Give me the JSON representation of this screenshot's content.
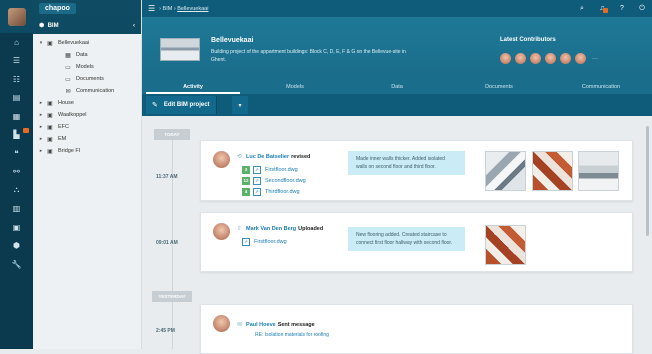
{
  "iconbar": {
    "items": [
      {
        "icon": "home-icon",
        "glyph": "⌂"
      },
      {
        "icon": "list-icon",
        "glyph": "☰"
      },
      {
        "icon": "users-icon",
        "glyph": "☷"
      },
      {
        "icon": "calendar-icon",
        "glyph": "▤"
      },
      {
        "icon": "clipboard-icon",
        "glyph": "▦"
      },
      {
        "icon": "chart-icon",
        "glyph": "▙"
      },
      {
        "icon": "quote-icon",
        "glyph": "❝"
      },
      {
        "icon": "link-icon",
        "glyph": "⚯"
      },
      {
        "icon": "sitemap-icon",
        "glyph": "⛬"
      },
      {
        "icon": "table-icon",
        "glyph": "▥"
      },
      {
        "icon": "folder-icon",
        "glyph": "▣"
      },
      {
        "icon": "cube-icon",
        "glyph": "⬢"
      },
      {
        "icon": "wrench-icon",
        "glyph": "🔧"
      }
    ]
  },
  "sidebar": {
    "brand": "chapoo",
    "section": "BIM",
    "tree": [
      {
        "label": "Bellevuekaai",
        "level": 1,
        "toggle": "▾",
        "icon": "▣"
      },
      {
        "label": "Data",
        "level": 2,
        "toggle": "",
        "icon": "▦"
      },
      {
        "label": "Models",
        "level": 2,
        "toggle": "",
        "icon": "▭"
      },
      {
        "label": "Documents",
        "level": 2,
        "toggle": "",
        "icon": "▭"
      },
      {
        "label": "Communication",
        "level": 2,
        "toggle": "",
        "icon": "✉"
      },
      {
        "label": "House",
        "level": 1,
        "toggle": "▸",
        "icon": "▣"
      },
      {
        "label": "Waalkoppel",
        "level": 1,
        "toggle": "▸",
        "icon": "▣"
      },
      {
        "label": "EFC",
        "level": 1,
        "toggle": "▸",
        "icon": "▣"
      },
      {
        "label": "EM",
        "level": 1,
        "toggle": "▸",
        "icon": "▣"
      },
      {
        "label": "Bridge FI",
        "level": 1,
        "toggle": "▸",
        "icon": "▣"
      }
    ]
  },
  "topbar": {
    "crumb_root": "BIM",
    "crumb_sep": "›",
    "crumb_current": "Bellevuekaai"
  },
  "header": {
    "title": "Bellevuekaai",
    "description": "Building project of the appartment buildings: Block C, D, E, F & G on the Bellevue-site in Ghent.",
    "contributors_title": "Latest Contributors",
    "contributor_count_shown": 6,
    "more": "···"
  },
  "tabs": [
    "Activity",
    "Models",
    "Data",
    "Documents",
    "Communication"
  ],
  "edit": {
    "label": "Edit BIM project",
    "dropdown": "▾"
  },
  "feed": {
    "today_label": "TODAY",
    "yesterday_label": "YESTERDAY",
    "entries": [
      {
        "time": "11:37 AM",
        "user": "Luc De Batselier",
        "action": "revised",
        "files": [
          {
            "version": "3",
            "name": "Firstfloor.dwg"
          },
          {
            "version": "12",
            "name": "Secondfloor.dwg"
          },
          {
            "version": "4",
            "name": "Thirdfloor.dwg"
          }
        ],
        "note": "Made inner walls thicker. Added isolated walls on second floor and third floor."
      },
      {
        "time": "09:01 AM",
        "user": "Mark Van Den Berg",
        "action": "Uploaded",
        "files": [
          {
            "version": "",
            "name": "Firstfloor.dwg"
          }
        ],
        "note": "New flooring added. Created staircase to connect first floor hallway with second floor."
      },
      {
        "time": "2:45 PM",
        "user": "Paul Hoeve",
        "action": "Sent message",
        "subject": "RE: Isolation materials for roofing"
      }
    ]
  }
}
